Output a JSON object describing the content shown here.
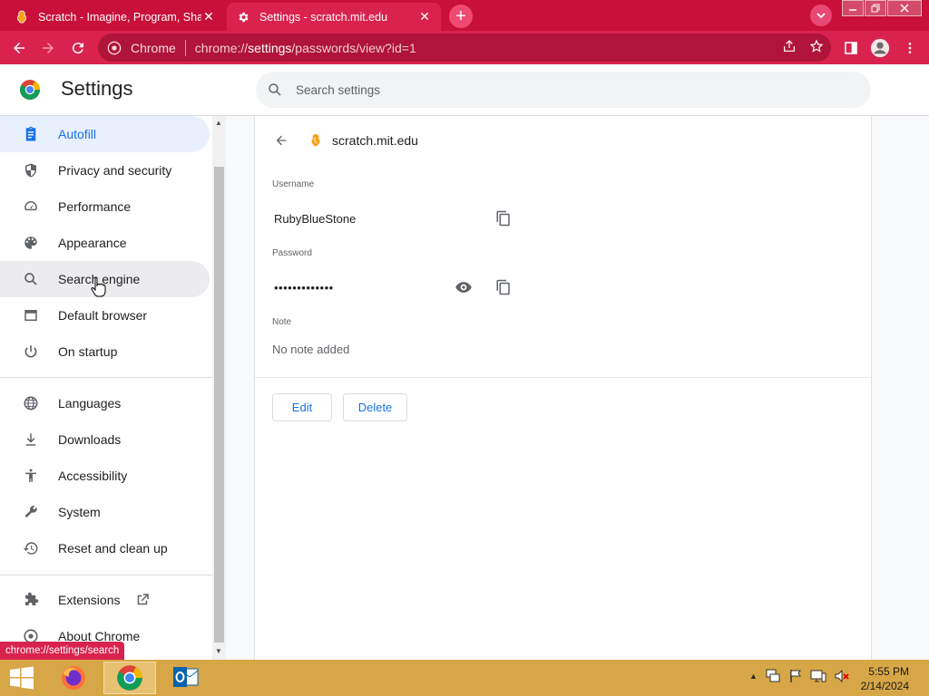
{
  "browser": {
    "tabs": [
      {
        "title": "Scratch - Imagine, Program, Share",
        "active": false
      },
      {
        "title": "Settings - scratch.mit.edu",
        "active": true
      }
    ],
    "omnibox": {
      "site_label": "Chrome",
      "url_prefix": "chrome://",
      "url_host": "settings",
      "url_path": "/passwords/view?id=1"
    },
    "status_url": "chrome://settings/search",
    "accent_color": "#d9234e"
  },
  "settings": {
    "title": "Settings",
    "search_placeholder": "Search settings",
    "sidebar": {
      "items": [
        {
          "label": "Autofill",
          "icon": "clipboard-icon",
          "state": "active"
        },
        {
          "label": "Privacy and security",
          "icon": "shield-icon"
        },
        {
          "label": "Performance",
          "icon": "speedometer-icon"
        },
        {
          "label": "Appearance",
          "icon": "palette-icon"
        },
        {
          "label": "Search engine",
          "icon": "search-icon",
          "state": "hover"
        },
        {
          "label": "Default browser",
          "icon": "browser-icon"
        },
        {
          "label": "On startup",
          "icon": "power-icon"
        },
        {
          "label": "Languages",
          "icon": "globe-icon"
        },
        {
          "label": "Downloads",
          "icon": "download-icon"
        },
        {
          "label": "Accessibility",
          "icon": "accessibility-icon"
        },
        {
          "label": "System",
          "icon": "wrench-icon"
        },
        {
          "label": "Reset and clean up",
          "icon": "history-icon"
        },
        {
          "label": "Extensions",
          "icon": "puzzle-icon"
        },
        {
          "label": "About Chrome",
          "icon": "chrome-icon"
        }
      ]
    },
    "password_entry": {
      "site": "scratch.mit.edu",
      "username_label": "Username",
      "username": "RubyBlueStone",
      "password_label": "Password",
      "password_masked": "•••••••••••••",
      "note_label": "Note",
      "note": "No note added",
      "edit_label": "Edit",
      "delete_label": "Delete"
    }
  },
  "taskbar": {
    "apps": [
      "firefox-icon",
      "chrome-icon",
      "outlook-icon"
    ],
    "time": "5:55 PM",
    "date": "2/14/2024"
  }
}
